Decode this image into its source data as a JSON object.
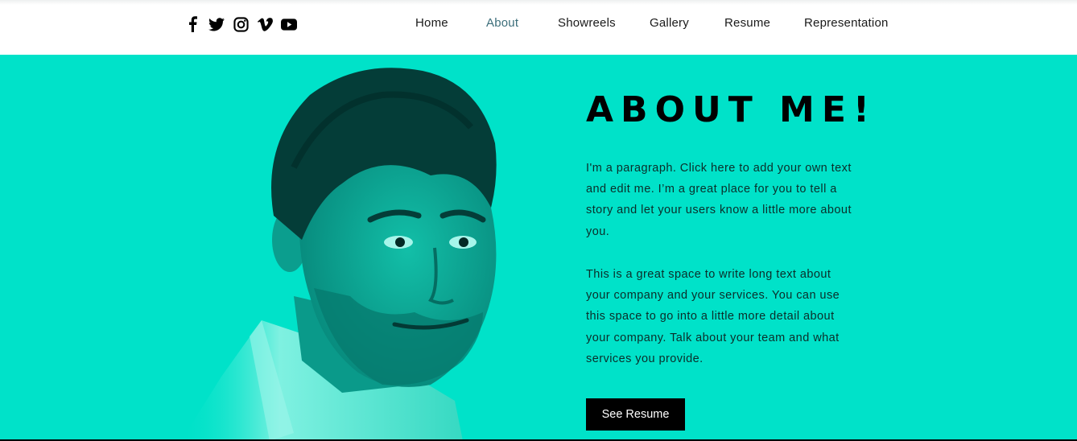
{
  "colors": {
    "hero_bg": "#00e2c9",
    "nav_active": "#3c6e7a",
    "button_bg": "#000000"
  },
  "social": [
    {
      "icon": "facebook-icon"
    },
    {
      "icon": "twitter-icon"
    },
    {
      "icon": "instagram-icon"
    },
    {
      "icon": "vimeo-icon"
    },
    {
      "icon": "youtube-icon"
    }
  ],
  "nav": {
    "items": [
      {
        "label": "Home"
      },
      {
        "label": "About"
      },
      {
        "label": "Showreels"
      },
      {
        "label": "Gallery"
      },
      {
        "label": "Resume"
      },
      {
        "label": "Representation"
      }
    ],
    "active": "About"
  },
  "about": {
    "title": "ABOUT ME!",
    "paragraph1": "I'm a paragraph. Click here to add your own text and edit me. I’m a great place for you to tell a story and let your users know a little more about you.",
    "paragraph2": "This is a great space to write long text about your company and your services. You can use this space to go into a little more detail about your company. Talk about your team and what services you provide.",
    "button_label": "See Resume"
  }
}
